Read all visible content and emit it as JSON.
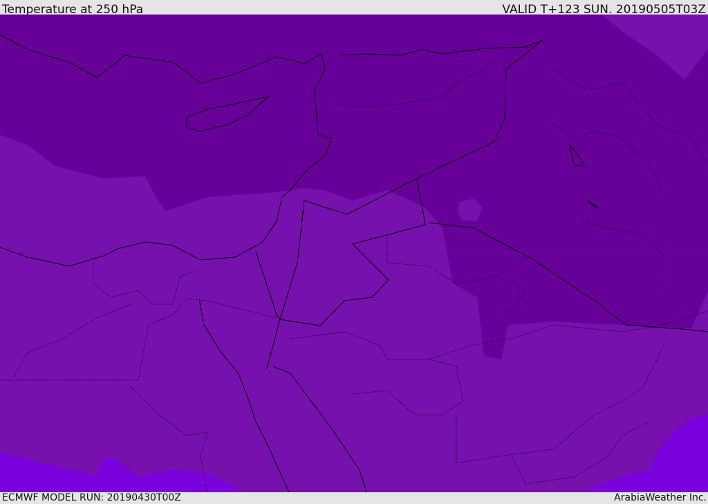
{
  "header": {
    "title": "Temperature at 250 hPa",
    "valid": "VALID T+123 SUN. 20190505T03Z"
  },
  "footer": {
    "model_run": "ECMWF MODEL RUN: 20190430T00Z",
    "credit": "ArabiaWeather Inc."
  },
  "colors": {
    "cold_band": "#660099",
    "mid_band": "#7711ae",
    "warm_band": "#7a00dd",
    "borders": "#000000"
  }
}
